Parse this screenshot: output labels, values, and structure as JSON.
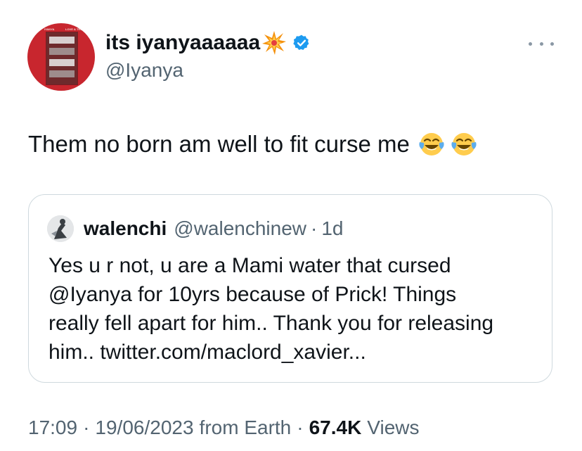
{
  "author": {
    "display_name": "its iyanyaaaaaa",
    "handle": "@Iyanya",
    "avatar_text_left": "IYANYA",
    "avatar_text_right": "LOVE & TRUST",
    "name_emoji": "collision-emoji",
    "verified_icon": "verified-badge-icon",
    "verified_color": "#1d9bf0"
  },
  "tweet": {
    "text": "Them no born am well to fit curse me",
    "emojis": [
      "face-with-tears-of-joy-emoji",
      "face-with-tears-of-joy-emoji"
    ]
  },
  "quote": {
    "name": "walenchi",
    "handle": "@walenchinew",
    "separator": "·",
    "time": "1d",
    "lines": [
      "Yes u r not, u are a Mami water that cursed",
      "@Iyanya for 10yrs because of Prick! Things",
      "really fell apart for him.. Thank you for releasing",
      "him.. twitter.com/maclord_xavier..."
    ]
  },
  "meta": {
    "time": "17:09",
    "separator": "·",
    "date": "19/06/2023",
    "source": "from Earth",
    "views_count": "67.4K",
    "views_label": "Views"
  },
  "colors": {
    "text_primary": "#0f1419",
    "text_secondary": "#536471",
    "border": "#cfd9de",
    "avatar_bg": "#c8262e"
  }
}
